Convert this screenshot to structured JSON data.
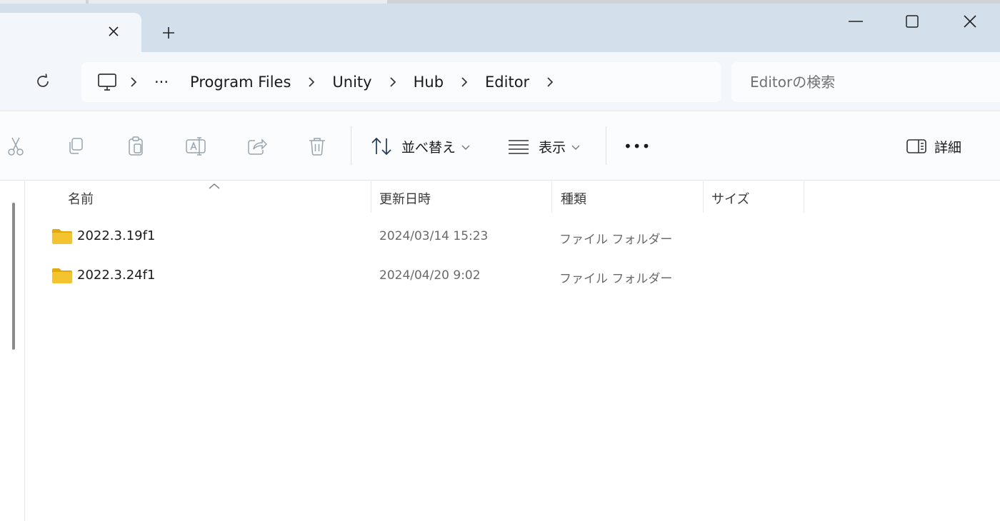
{
  "window": {
    "tab_close_glyph": "✕",
    "new_tab_glyph": "+",
    "minimize_glyph": "—",
    "close_glyph": "✕"
  },
  "address": {
    "more_glyph": "···",
    "crumbs": [
      "Program Files",
      "Unity",
      "Hub",
      "Editor"
    ],
    "search_placeholder": "Editorの検索"
  },
  "commands": {
    "sort_label": "並べ替え",
    "view_label": "表示",
    "more_glyph": "•••",
    "details_label": "詳細"
  },
  "columns": {
    "name": "名前",
    "modified": "更新日時",
    "type": "種類",
    "size": "サイズ"
  },
  "files": [
    {
      "name": "2022.3.19f1",
      "modified": "2024/03/14 15:23",
      "type": "ファイル フォルダー",
      "size": ""
    },
    {
      "name": "2022.3.24f1",
      "modified": "2024/04/20 9:02",
      "type": "ファイル フォルダー",
      "size": ""
    }
  ],
  "colors": {
    "titlebar": "#d3e0ec",
    "folder": "#f4c430",
    "folder_dark": "#e2a90a"
  }
}
